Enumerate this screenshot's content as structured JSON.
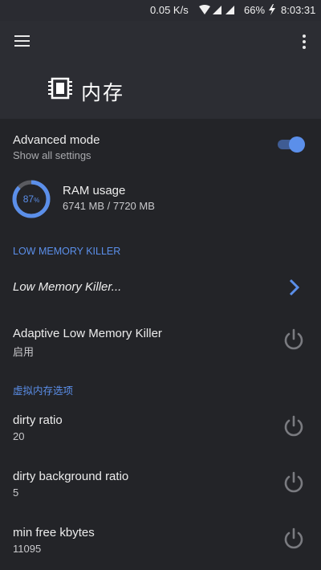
{
  "status_bar": {
    "speed": "0.05 K/s",
    "battery": "66%",
    "time": "8:03:31",
    "icons": [
      "wifi-icon",
      "signal-icon",
      "signal-icon",
      "charging-bolt-icon"
    ]
  },
  "header": {
    "title": "内存",
    "icon": "memory-chip-icon"
  },
  "advanced_mode": {
    "title": "Advanced mode",
    "subtitle": "Show all settings",
    "enabled": true
  },
  "ram": {
    "title": "RAM usage",
    "detail": "6741 MB / 7720 MB",
    "percent_label": "87",
    "percent_symbol": "%",
    "fraction": 0.87
  },
  "sections": {
    "lmk_header": "LOW MEMORY KILLER",
    "vm_header": "虚拟内存选项"
  },
  "lmk_link": {
    "title": "Low Memory Killer..."
  },
  "adaptive_lmk": {
    "title": "Adaptive Low Memory Killer",
    "value": "启用"
  },
  "dirty_ratio": {
    "title": "dirty ratio",
    "value": "20"
  },
  "dirty_bg_ratio": {
    "title": "dirty background ratio",
    "value": "5"
  },
  "min_free": {
    "title": "min free kbytes",
    "value": "11095"
  },
  "colors": {
    "accent": "#5b8fea",
    "background": "#232428",
    "appbar": "#2c2d33",
    "power_icon": "#7a7b80"
  }
}
